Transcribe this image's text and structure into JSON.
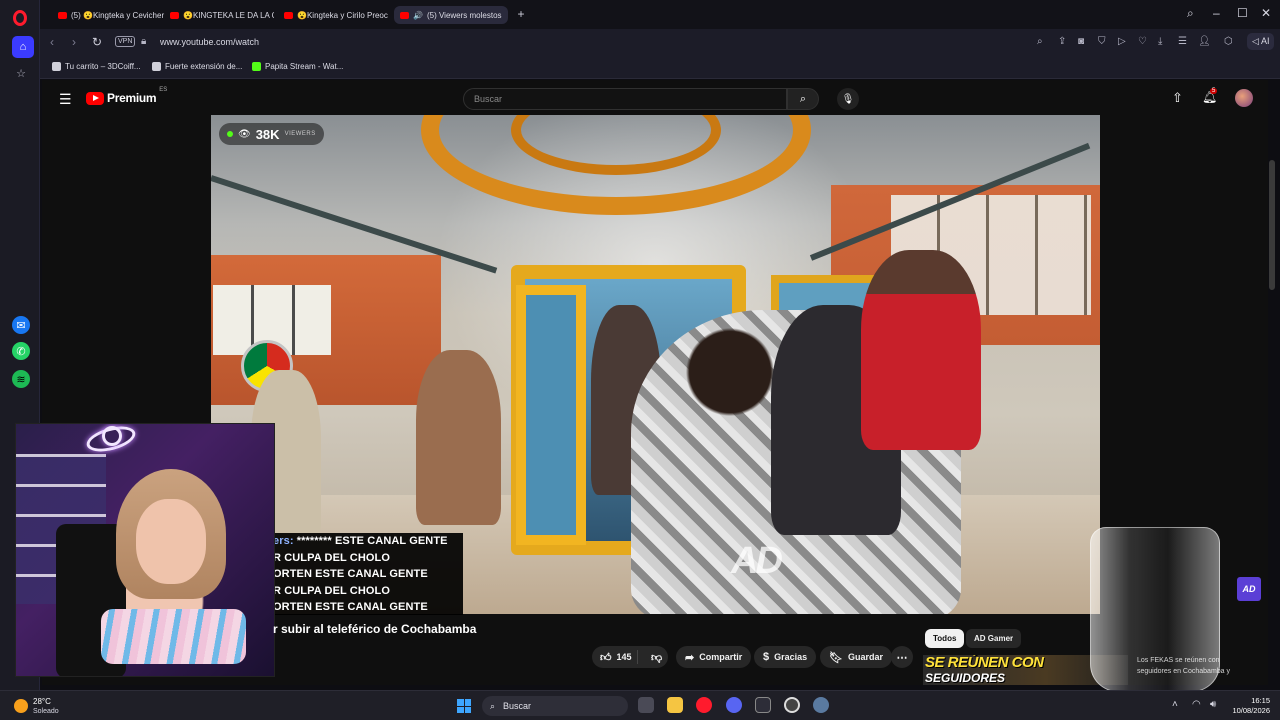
{
  "browser": {
    "tabs": [
      {
        "label": "(5) 😮Kingteka y Cevicher"
      },
      {
        "label": "😮KINGTEKA LE DA LA CO"
      },
      {
        "label": "😮Kingteka y Cirilo Preoc"
      },
      {
        "label": "(5) Viewers molestos"
      }
    ],
    "vpn_label": "VPN",
    "url": "www.youtube.com/watch",
    "ai_label": "AI",
    "bookmarks": [
      {
        "label": "Tu carrito – 3DCoiff..."
      },
      {
        "label": "Fuerte extensión de..."
      },
      {
        "label": "Papita Stream - Wat..."
      }
    ]
  },
  "youtube": {
    "logo_text": "Premium",
    "country_code": "ES",
    "search_placeholder": "Buscar",
    "notification_count": "5",
    "video": {
      "viewer_count": "38K",
      "viewer_label": "VIEWERS",
      "watermark": "AD"
    },
    "chat_lines": [
      {
        "user": "ers:",
        "text": " ******** ESTE CANAL GENTE"
      },
      {
        "user": "",
        "text": "R CULPA DEL CHOLO"
      },
      {
        "user": "",
        "text": "ORTEN ESTE CANAL GENTE"
      },
      {
        "user": "",
        "text": "R CULPA DEL CHOLO"
      },
      {
        "user": "",
        "text": "ORTEN ESTE CANAL GENTE"
      }
    ],
    "title": "r subir al teleférico de Cochabamba",
    "actions": {
      "likes": "145",
      "share": "Compartir",
      "thanks": "Gracias",
      "save": "Guardar"
    },
    "chips": [
      "Todos",
      "AD Gamer"
    ],
    "recommendation": {
      "thumb_line1": "SE REÚNEN CON",
      "thumb_line2": "SEGUIDORES",
      "title": "Los FEKAS se reúnen con seguidores en Cochabamba y"
    },
    "ad_badge": "AD"
  },
  "taskbar": {
    "temperature": "28°C",
    "weather": "Soleado",
    "search": "Buscar",
    "time": "16:15",
    "date": "10/08/2026"
  }
}
